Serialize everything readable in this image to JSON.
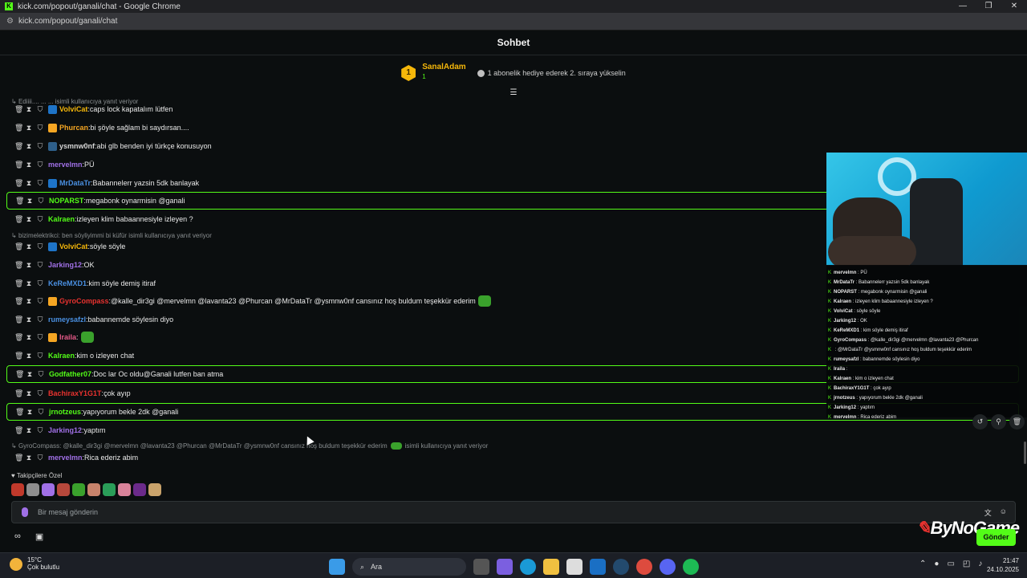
{
  "window": {
    "title": "kick.com/popout/ganali/chat - Google Chrome",
    "url": "kick.com/popout/ganali/chat"
  },
  "chat": {
    "header": "Sohbet"
  },
  "pinned": {
    "rank": "1",
    "top_user": "SanalAdam",
    "top_count": "1",
    "gift_text": "1 abonelik hediye ederek 2. sıraya yükselin"
  },
  "messages": [
    {
      "user": "VolviCat",
      "text": "caps lock kapatalım lütfen",
      "color": "#f5b70a",
      "highlight": false
    },
    {
      "user": "Phurcan",
      "text": "bi şöyle sağlam bi saydırsan....",
      "color": "#f5a623",
      "highlight": false
    },
    {
      "user": "ysmnw0nf",
      "text": "abi glb benden iyi türkçe konusuyon",
      "color": "#d6d6d6",
      "highlight": false
    },
    {
      "user": "mervelmn",
      "text": "PÜ",
      "color": "#a070e6",
      "highlight": false
    },
    {
      "user": "MrDataTr",
      "text": "Babannelerr yazsin 5dk banlayak",
      "color": "#4a90e2",
      "highlight": false
    },
    {
      "user": "NOPARST",
      "text": "megabonk oynarmisin @ganali",
      "color": "#53fc18",
      "highlight": true
    },
    {
      "user": "Kalraen",
      "text": "izleyen klim babaannesiyle izleyen ?",
      "color": "#53fc18",
      "highlight": false
    },
    {
      "user": "VolviCat",
      "text": "söyle söyle",
      "color": "#f5b70a",
      "highlight": false
    },
    {
      "user": "Jarking12",
      "text": "OK",
      "color": "#a070e6",
      "highlight": false
    },
    {
      "user": "KeReMXD1",
      "text": "kim söyle demiş itiraf",
      "color": "#4a90e2",
      "highlight": false
    },
    {
      "user": "GyroCompass",
      "text": "@kalle_dir3gi @mervelmn @lavanta23 @Phurcan @MrDataTr @ysmnw0nf cansınız hoş buldum teşekkür ederim",
      "color": "#e8322f",
      "highlight": false
    },
    {
      "user": "rumeysafzl",
      "text": "babannemde söylesin diyo",
      "color": "#4a90e2",
      "highlight": false
    },
    {
      "user": "Iraila",
      "text": "",
      "color": "#e85a8a",
      "highlight": false
    },
    {
      "user": "Kalraen",
      "text": "kim o izleyen chat",
      "color": "#53fc18",
      "highlight": false
    },
    {
      "user": "Godfather07",
      "text": "Doc lar Oc oldu@Ganali lutfen ban atma",
      "color": "#53fc18",
      "highlight": true
    },
    {
      "user": "BachiraxY1G1T",
      "text": "çok ayıp",
      "color": "#e8322f",
      "highlight": false
    },
    {
      "user": "jrnotzeus",
      "text": "yapıyorum bekle 2dk @ganali",
      "color": "#53fc18",
      "highlight": true
    },
    {
      "user": "Jarking12",
      "text": "yaptım",
      "color": "#a070e6",
      "highlight": false
    },
    {
      "user": "mervelmn",
      "text": "Rica ederiz abim",
      "color": "#a070e6",
      "highlight": false
    }
  ],
  "replies": {
    "top": "Ediiii.... ... ... isimli kullanıcıya yanıt veriyor",
    "r1": "bizimelektrikci: ben söyliyimmi bi küfür isimli kullanıcıya yanıt veriyor",
    "r2a": "GyroCompass: @kalle_dir3gi @mervelmn @lavanta23 @Phurcan @MrDataTr @ysmnw0nf cansınız hoş buldum teşekkür ederim",
    "r2b": "isimli kullanıcıya yanıt veriyor"
  },
  "overlay": [
    {
      "user": "mervelmn",
      "text": "PÜ"
    },
    {
      "user": "MrDataTr",
      "text": "Babannelerr yazsin 5dk banlayak"
    },
    {
      "user": "NOPARST",
      "text": "megabonk oynarmisin @ganali"
    },
    {
      "user": "Kalraen",
      "text": "izleyen klim babaannesiyle izleyen ?"
    },
    {
      "user": "VolviCat",
      "text": "söyle söyle"
    },
    {
      "user": "Jarking12",
      "text": "OK"
    },
    {
      "user": "KeReMXD1",
      "text": "kim söyle demiş itiraf"
    },
    {
      "user": "GyroCompass",
      "text": "@kalle_dir3gi @mervelmn @lavanta23 @Phurcan"
    },
    {
      "user": "",
      "text": "@MrDataTr @ysmnw0nf cansınız hoş buldum teşekkür ederim"
    },
    {
      "user": "rumeysafzl",
      "text": "babannemde söylesin diyo"
    },
    {
      "user": "Iraila",
      "text": ""
    },
    {
      "user": "Kalraen",
      "text": "kim o izleyen chat"
    },
    {
      "user": "BachiraxY1G1T",
      "text": "çok ayıp"
    },
    {
      "user": "jrnotzeus",
      "text": "yapıyorum bekle 2dk @ganali"
    },
    {
      "user": "Jarking12",
      "text": "yaptım"
    },
    {
      "user": "mervelmn",
      "text": "Rica ederiz abim"
    }
  ],
  "footer": {
    "followers_label": "Takipçilere Özel",
    "input_placeholder": "Bir mesaj gönderin",
    "send_label": "Gönder",
    "brand": "ByNoGame"
  },
  "taskbar": {
    "temp": "15°C",
    "weather": "Çok bulutlu",
    "search": "Ara",
    "time": "21:47",
    "date": "24.10.2025"
  },
  "colors": {
    "accent": "#53fc18",
    "background": "#0b0e0f"
  }
}
